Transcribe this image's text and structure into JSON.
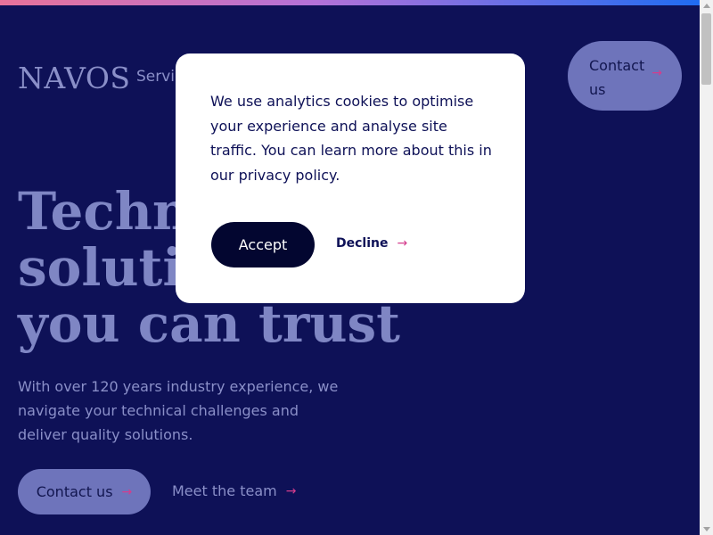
{
  "brand": {
    "logo_text": "NAVOS"
  },
  "nav": {
    "services_label": "Servic",
    "contact_label": "Contact us",
    "arrow": "→"
  },
  "hero": {
    "title_lines": [
      "Techno",
      "solutio",
      "you can trust"
    ],
    "subtitle": "With over 120 years industry experience, we navigate your technical challenges and deliver quality solutions.",
    "contact_label": "Contact us",
    "team_label": "Meet the team",
    "arrow": "→"
  },
  "cookie_modal": {
    "message": "We use analytics cookies to optimise your experience and analyse site traffic. You can learn more about this in our privacy policy.",
    "accept_label": "Accept",
    "decline_label": "Decline",
    "arrow": "→"
  },
  "colors": {
    "background": "#0e1157",
    "accent_gradient": [
      "#e8739a",
      "#b472d8",
      "#1f6cf2"
    ],
    "arrow_accent": "#d43d8d",
    "button_dark": "#030630"
  }
}
